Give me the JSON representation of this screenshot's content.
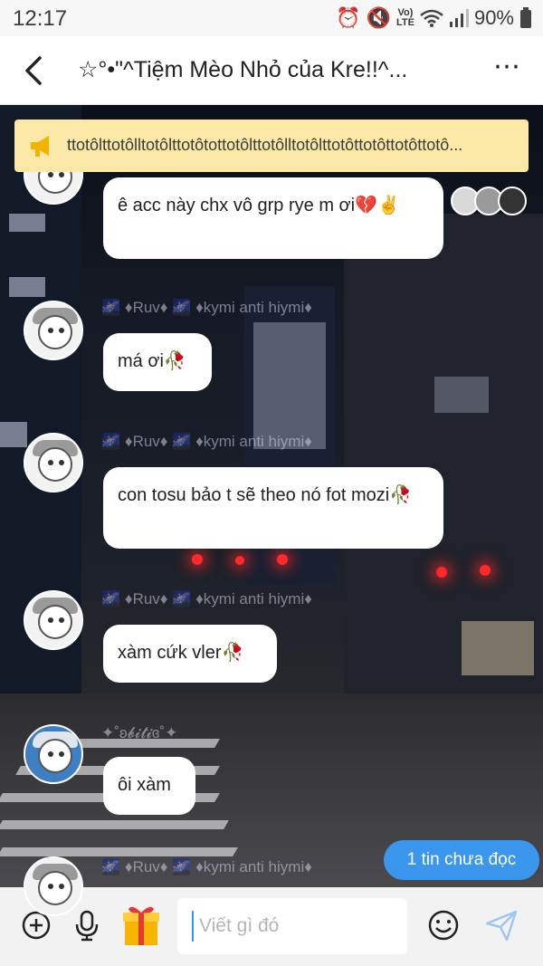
{
  "status_bar": {
    "time": "12:17",
    "network_label_top": "Vo)",
    "network_label_bottom": "LTE",
    "battery_percent": "90%"
  },
  "header": {
    "title": "☆°•\"^Tiệm Mèo Nhỏ của Kre!!^...",
    "more_icon": "⋯"
  },
  "pinned": {
    "text": "ttotôlttotôlltotôlttotôtottotôlttotôlltotôlttotôttotôttotôttotô..."
  },
  "messages": [
    {
      "sender": "",
      "text": "ê acc này chx vô grp rye m ơi💔✌️"
    },
    {
      "sender": "🌌 ♦Ruv♦ 🌌 ♦kymi anti hiymi♦",
      "text": "má ơi🥀"
    },
    {
      "sender": "🌌 ♦Ruv♦ 🌌 ♦kymi anti hiymi♦",
      "text": "con tosu bảo t sẽ theo nó fot mozi🥀"
    },
    {
      "sender": "🌌 ♦Ruv♦ 🌌 ♦kymi anti hiymi♦",
      "text": "xàm cứk vler🥀"
    },
    {
      "sender": "✦˚ʚ𝓫𝓲𝓽𝓲ɞ˚✦",
      "text": "ôi xàm"
    },
    {
      "sender": "🌌 ♦Ruv♦ 🌌 ♦kymi anti hiymi♦",
      "text": ""
    }
  ],
  "unread": {
    "label": "1 tin chưa đọc"
  },
  "input": {
    "placeholder": "Viết gì đó",
    "value": ""
  },
  "colors": {
    "accent": "#3b97ee",
    "pinned_bg": "#fbe8a6",
    "bubble_bg": "#ffffff"
  }
}
